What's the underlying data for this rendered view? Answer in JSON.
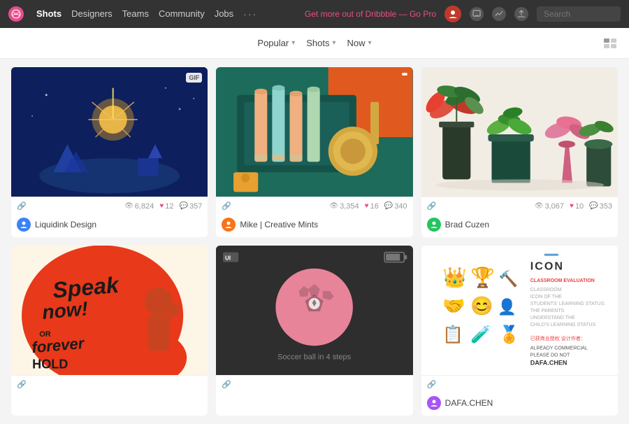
{
  "nav": {
    "logo_text": "dribbble",
    "links": [
      {
        "label": "Shots",
        "active": true
      },
      {
        "label": "Designers",
        "active": false
      },
      {
        "label": "Teams",
        "active": false
      },
      {
        "label": "Community",
        "active": false
      },
      {
        "label": "Jobs",
        "active": false
      }
    ],
    "go_pro_text": "Get more out of Dribbble — Go Pro",
    "search_placeholder": "Search"
  },
  "filters": {
    "popular_label": "Popular",
    "shots_label": "Shots",
    "now_label": "Now"
  },
  "shots": [
    {
      "id": 1,
      "thumb_type": "fireworks",
      "badge": "GIF",
      "stats": {
        "views": "6,824",
        "hearts": "12",
        "comments": "357"
      },
      "author": {
        "name": "Liquidink Design",
        "badge_color": "#3b82f6"
      }
    },
    {
      "id": 2,
      "thumb_type": "pencils",
      "badge": "",
      "stats": {
        "views": "3,354",
        "hearts": "16",
        "comments": "340"
      },
      "author": {
        "name": "Mike | Creative Mints",
        "badge_color": "#f97316"
      }
    },
    {
      "id": 3,
      "thumb_type": "plants",
      "badge": "",
      "stats": {
        "views": "3,067",
        "hearts": "10",
        "comments": "353"
      },
      "author": {
        "name": "Brad Cuzen",
        "badge_color": "#22c55e"
      }
    },
    {
      "id": 4,
      "thumb_type": "speak",
      "badge": "",
      "stats": {
        "views": "",
        "hearts": "",
        "comments": ""
      },
      "author": {
        "name": "",
        "badge_color": ""
      }
    },
    {
      "id": 5,
      "thumb_type": "soccer",
      "badge": "",
      "stats": {
        "views": "",
        "hearts": "",
        "comments": ""
      },
      "author": {
        "name": "",
        "badge_color": ""
      },
      "label": "Soccer ball in 4 steps"
    },
    {
      "id": 6,
      "thumb_type": "icons",
      "badge": "",
      "stats": {
        "views": "",
        "hearts": "",
        "comments": ""
      },
      "author": {
        "name": "DAFA.CHEN",
        "badge_color": "#a855f7"
      }
    }
  ]
}
